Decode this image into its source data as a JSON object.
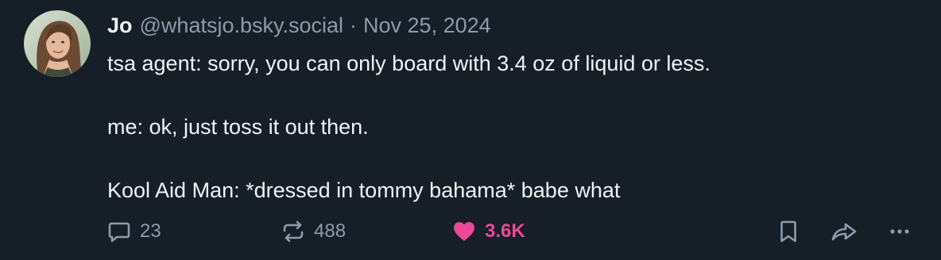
{
  "post": {
    "author": {
      "display_name": "Jo",
      "handle": "@whatsjo.bsky.social",
      "separator": "·",
      "timestamp": "Nov 25, 2024"
    },
    "text_lines": [
      "tsa agent: sorry, you can only board with 3.4 oz of liquid or less.",
      "",
      "me: ok, just toss it out then.",
      "",
      "Kool Aid Man: *dressed in tommy bahama* babe what"
    ],
    "actions": {
      "reply_count": "23",
      "repost_count": "488",
      "like_count": "3.6K",
      "liked": true
    },
    "icons": {
      "reply": "speech-bubble-icon",
      "repost": "repost-arrows-icon",
      "like": "heart-icon",
      "bookmark": "bookmark-icon",
      "share": "share-arrow-icon",
      "more": "ellipsis-icon"
    },
    "colors": {
      "background": "#161e27",
      "text": "#f1f3f5",
      "muted": "#8c9bab",
      "like": "#ec4899"
    }
  }
}
